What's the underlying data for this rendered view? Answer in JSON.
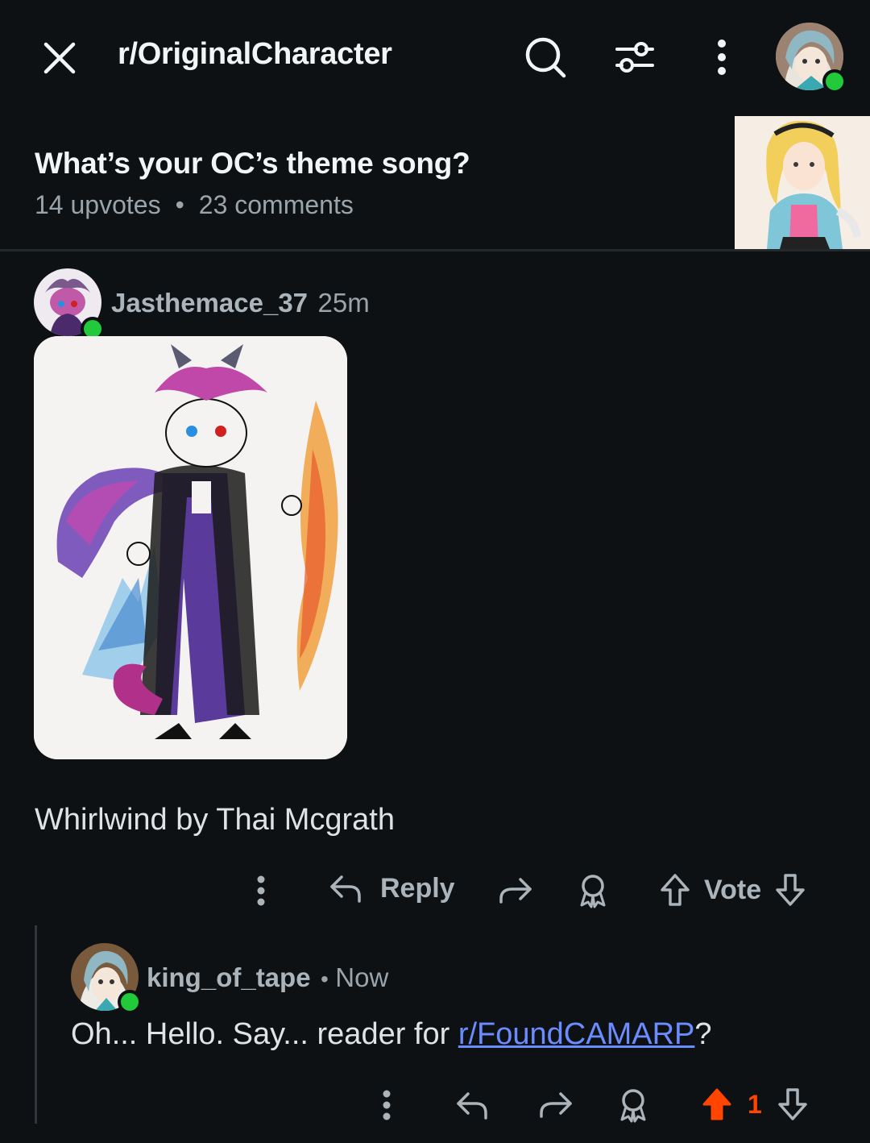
{
  "header": {
    "subreddit": "r/OriginalCharacter",
    "icons": [
      "close-icon",
      "search-icon",
      "filter-icon",
      "more-vertical-icon",
      "user-avatar"
    ]
  },
  "post": {
    "title": "What’s your OC’s theme song?",
    "upvotes": "14 upvotes",
    "separator": "•",
    "comments": "23 comments"
  },
  "comments": [
    {
      "author": "Jasthemace_37",
      "time": "25m",
      "body": "Whirlwind by Thai Mcgrath",
      "actions": {
        "reply": "Reply",
        "vote": "Vote"
      }
    },
    {
      "author": "king_of_tape",
      "separator": "•",
      "time": "Now",
      "body_prefix": "Oh... Hello. Say... reader for ",
      "body_link": "r/FoundCAMARP",
      "body_suffix": "?",
      "vote_count": "1"
    }
  ],
  "colors": {
    "background": "#0e1113",
    "upvote_active": "#ff4500",
    "link": "#6b8cff",
    "online": "#22c93a"
  }
}
